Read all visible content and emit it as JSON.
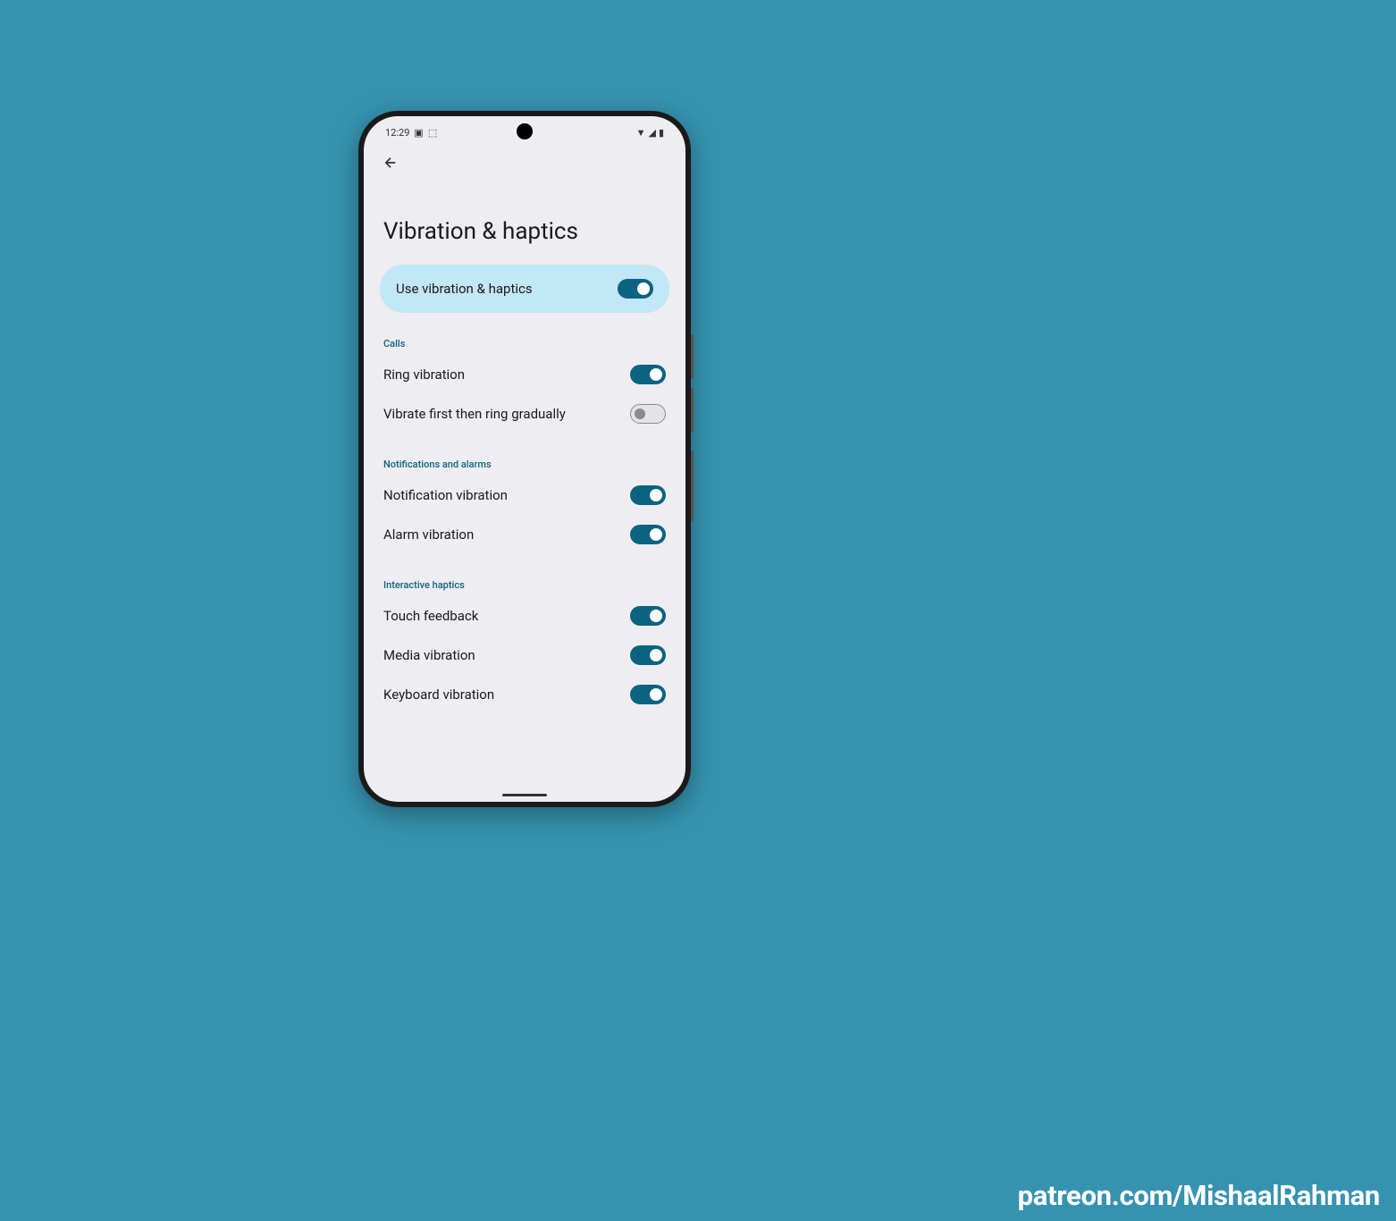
{
  "status_bar": {
    "time": "12:29",
    "icon_debug": "▣",
    "icon_bug": "⬚",
    "icon_wifi": "▼",
    "icon_signal": "◢",
    "icon_battery": "▮"
  },
  "page": {
    "title": "Vibration & haptics"
  },
  "main_toggle": {
    "label": "Use vibration & haptics",
    "on": true
  },
  "sections": {
    "calls": {
      "header": "Calls",
      "items": [
        {
          "key": "ring-vibration",
          "label": "Ring vibration",
          "on": true
        },
        {
          "key": "vibrate-first",
          "label": "Vibrate first then ring gradually",
          "on": false
        }
      ]
    },
    "notifications": {
      "header": "Notifications and alarms",
      "items": [
        {
          "key": "notification-vibration",
          "label": "Notification vibration",
          "on": true
        },
        {
          "key": "alarm-vibration",
          "label": "Alarm vibration",
          "on": true
        }
      ]
    },
    "interactive": {
      "header": "Interactive haptics",
      "items": [
        {
          "key": "touch-feedback",
          "label": "Touch feedback",
          "on": true
        },
        {
          "key": "media-vibration",
          "label": "Media vibration",
          "on": true
        },
        {
          "key": "keyboard-vibration",
          "label": "Keyboard vibration",
          "on": true
        }
      ]
    }
  },
  "watermark": "patreon.com/MishaalRahman"
}
